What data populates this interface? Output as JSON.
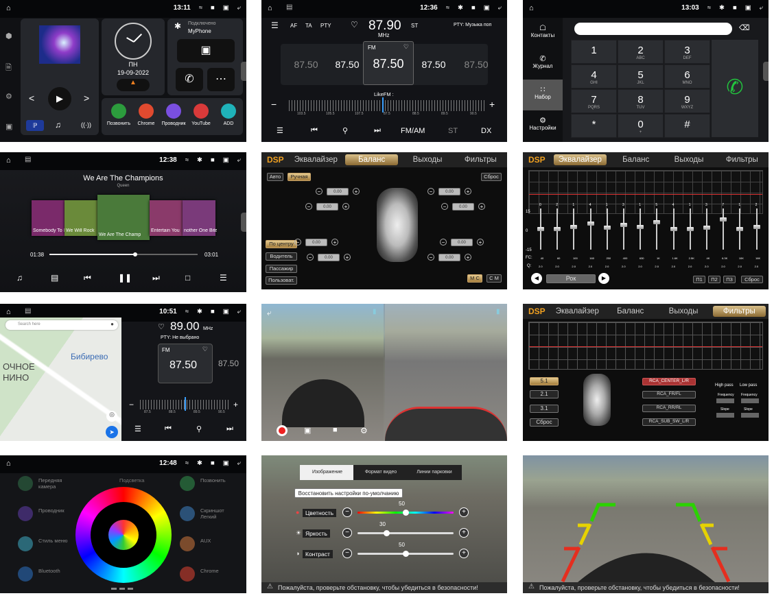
{
  "p1": {
    "time": "13:11",
    "connected": "Подключено",
    "phone": "MyPhone",
    "day": "ПН",
    "date": "19-09-2022",
    "apps": [
      "Позвонить",
      "Chrome",
      "Проводник",
      "YouTube",
      "ADD"
    ],
    "app_colors": [
      "#2c9c3d",
      "#e04a2f",
      "#7a4fe0",
      "#d93a3a",
      "#1fb2b9"
    ]
  },
  "p2": {
    "time": "12:36",
    "flags": [
      "AF",
      "TA",
      "PTY"
    ],
    "freq": "87.90",
    "unit": "MHz",
    "st": "ST",
    "pty": "PTY: Музыка поп",
    "fm": "FM",
    "presets": [
      "87.50",
      "87.50",
      "87.50",
      "87.50",
      "87.50"
    ],
    "likefm": "LikeFM :",
    "scale": [
      "103.5",
      "105.5",
      "107.5",
      "87.5",
      "88.5",
      "89.5",
      "90.5"
    ],
    "bottom": [
      "FM/AM",
      "ST",
      "DX"
    ]
  },
  "p3": {
    "time": "13:03",
    "side": [
      "Контакты",
      "Журнал",
      "Набор",
      "Настройки"
    ],
    "keys": [
      [
        "1",
        ""
      ],
      [
        "2",
        "ABC"
      ],
      [
        "3",
        "DEF"
      ],
      [
        "4",
        "GHI"
      ],
      [
        "5",
        "JKL"
      ],
      [
        "6",
        "MNO"
      ],
      [
        "7",
        "PQRS"
      ],
      [
        "8",
        "TUV"
      ],
      [
        "9",
        "WXYZ"
      ],
      [
        "*",
        ""
      ],
      [
        "0",
        "+"
      ],
      [
        "#",
        ""
      ]
    ]
  },
  "p4": {
    "time": "12:38",
    "title": "We Are The Champions",
    "artist": "Queen",
    "covers": [
      "Somebody To Lov",
      "We Will Rock",
      "We Are The Champ",
      "Entertain You",
      "nother One Bites"
    ],
    "t_cur": "01:38",
    "t_end": "03:01",
    "progress": 0.58
  },
  "p5": {
    "dsp": "DSP",
    "tabs": [
      "Эквалайзер",
      "Баланс",
      "Выходы",
      "Фильтры"
    ],
    "active": 1,
    "modes": [
      "Авто",
      "Ручная"
    ],
    "reset": "Сброс",
    "val": "0.00",
    "presets": [
      "По центру",
      "Водитель",
      "Пассажир",
      "Пользоват."
    ],
    "mc": "М С",
    "cm": "С М"
  },
  "p6": {
    "dsp": "DSP",
    "tabs": [
      "Эквалайзер",
      "Баланс",
      "Выходы",
      "Фильтры"
    ],
    "active": 0,
    "top": [
      "0",
      "2",
      "1",
      "4",
      "1",
      "3",
      "1",
      "5",
      "4",
      "1",
      "3",
      "7",
      "1",
      "2"
    ],
    "ylabels": [
      "15",
      "0",
      "-15"
    ],
    "fc_label": "FC:",
    "fc": [
      "40",
      "60",
      "100",
      "160",
      "250",
      "400",
      "630",
      "1K",
      "1.6K",
      "2.5K",
      "4K",
      "6.3K",
      "10K",
      "16K"
    ],
    "q_label": "Q:",
    "q": "2.0",
    "preset": "Рок",
    "p": [
      "П1",
      "П2",
      "П3"
    ],
    "reset": "Сброс",
    "levels": [
      0.45,
      0.45,
      0.4,
      0.32,
      0.42,
      0.35,
      0.4,
      0.28,
      0.45,
      0.45,
      0.42,
      0.22,
      0.45,
      0.4
    ]
  },
  "p7": {
    "time": "10:51",
    "search": "Search here",
    "map1": "ОЧНОЕ",
    "map2": "НИНО",
    "district": "Бибирево",
    "freq": "89.00",
    "unit": "MHz",
    "pty": "PTY: Не выбрано",
    "fm": "FM",
    "preset": "87.50",
    "preset2": "87.50",
    "scale": [
      "87.5",
      "88.5",
      "89.5",
      "90.5"
    ]
  },
  "p9": {
    "dsp": "DSP",
    "tabs": [
      "Эквалайзер",
      "Баланс",
      "Выходы",
      "Фильтры"
    ],
    "active": 3,
    "modes": [
      "5.1",
      "2.1",
      "3.1",
      "Сброс"
    ],
    "channels": [
      "RCA_CENTER_L/R",
      "RCA_FR/FL",
      "RCA_RR/RL",
      "RCA_SUB_SW_L/R"
    ],
    "hp": "High pass",
    "lp": "Low pass",
    "freq": "Frequency",
    "slope": "Slope"
  },
  "p10": {
    "time": "12:48",
    "left": [
      "Передняя камера",
      "Проводник",
      "Стиль меню",
      "Bluetooth"
    ],
    "mid": "Подсветка",
    "right": [
      "Позвонить",
      "Скриншот Легкий",
      "AUX",
      "Chrome"
    ]
  },
  "p11": {
    "tabs": [
      "Изображение",
      "Формат видео",
      "Линии парковки"
    ],
    "restore": "Восстановить настройки по-умолчанию",
    "rows": [
      [
        "Цветность",
        "50"
      ],
      [
        "Яркость",
        "30"
      ],
      [
        "Контраст",
        "50"
      ]
    ],
    "levels": [
      0.5,
      0.3,
      0.5
    ],
    "warn": "Пожалуйста, проверьте обстановку, чтобы убедиться в безопасности!"
  },
  "p12": {
    "warn": "Пожалуйста, проверьте обстановку, чтобы убедиться в безопасности!"
  }
}
